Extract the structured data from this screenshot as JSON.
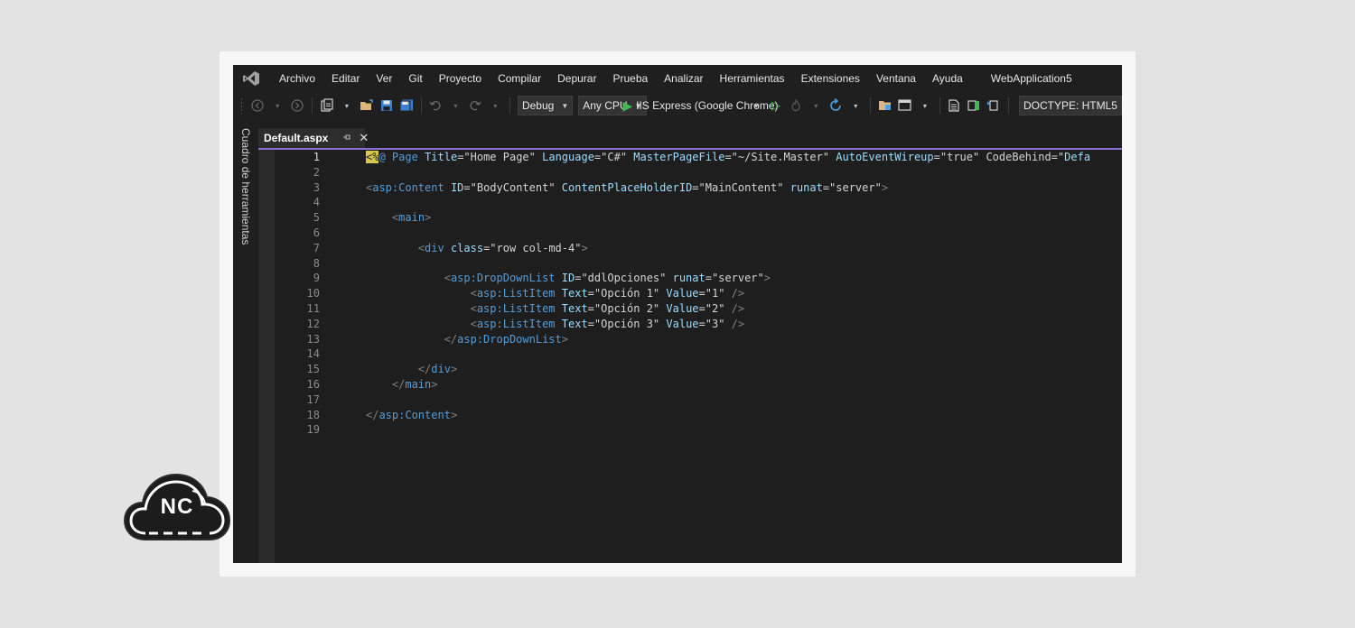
{
  "menubar": {
    "items": [
      "Archivo",
      "Editar",
      "Ver",
      "Git",
      "Proyecto",
      "Compilar",
      "Depurar",
      "Prueba",
      "Analizar",
      "Herramientas",
      "Extensiones",
      "Ventana",
      "Ayuda"
    ],
    "solution_name": "WebApplication5"
  },
  "toolbar": {
    "configuration": "Debug",
    "platform": "Any CPU",
    "run_target": "IIS Express (Google Chrome)",
    "doctype": "DOCTYPE: HTML5"
  },
  "side_panel": {
    "label": "Cuadro de herramientas"
  },
  "tab": {
    "filename": "Default.aspx",
    "pin_icon": "pin-icon",
    "close_glyph": "✕"
  },
  "editor": {
    "line_numbers": [
      "1",
      "2",
      "3",
      "4",
      "5",
      "6",
      "7",
      "8",
      "9",
      "10",
      "11",
      "12",
      "13",
      "14",
      "15",
      "16",
      "17",
      "18",
      "19"
    ],
    "current_line": 1,
    "lines": [
      "<%@ Page Title=\"Home Page\" Language=\"C#\" MasterPageFile=\"~/Site.Master\" AutoEventWireup=\"true\" CodeBehind=\"Defa",
      "",
      "<asp:Content ID=\"BodyContent\" ContentPlaceHolderID=\"MainContent\" runat=\"server\">",
      "",
      "    <main>",
      "",
      "        <div class=\"row col-md-4\">",
      "",
      "            <asp:DropDownList ID=\"ddlOpciones\" runat=\"server\">",
      "                <asp:ListItem Text=\"Opción 1\" Value=\"1\" />",
      "                <asp:ListItem Text=\"Opción 2\" Value=\"2\" />",
      "                <asp:ListItem Text=\"Opción 3\" Value=\"3\" />",
      "            </asp:DropDownList>",
      "",
      "        </div>",
      "    </main>",
      "",
      "</asp:Content>",
      ""
    ]
  },
  "watermark": {
    "text": "NC"
  },
  "colors": {
    "tag": "#569cd6",
    "attribute": "#9cdcfe",
    "string": "#d4d4d4",
    "tab_accent": "#8c6fd0",
    "run_green": "#3fb950"
  }
}
